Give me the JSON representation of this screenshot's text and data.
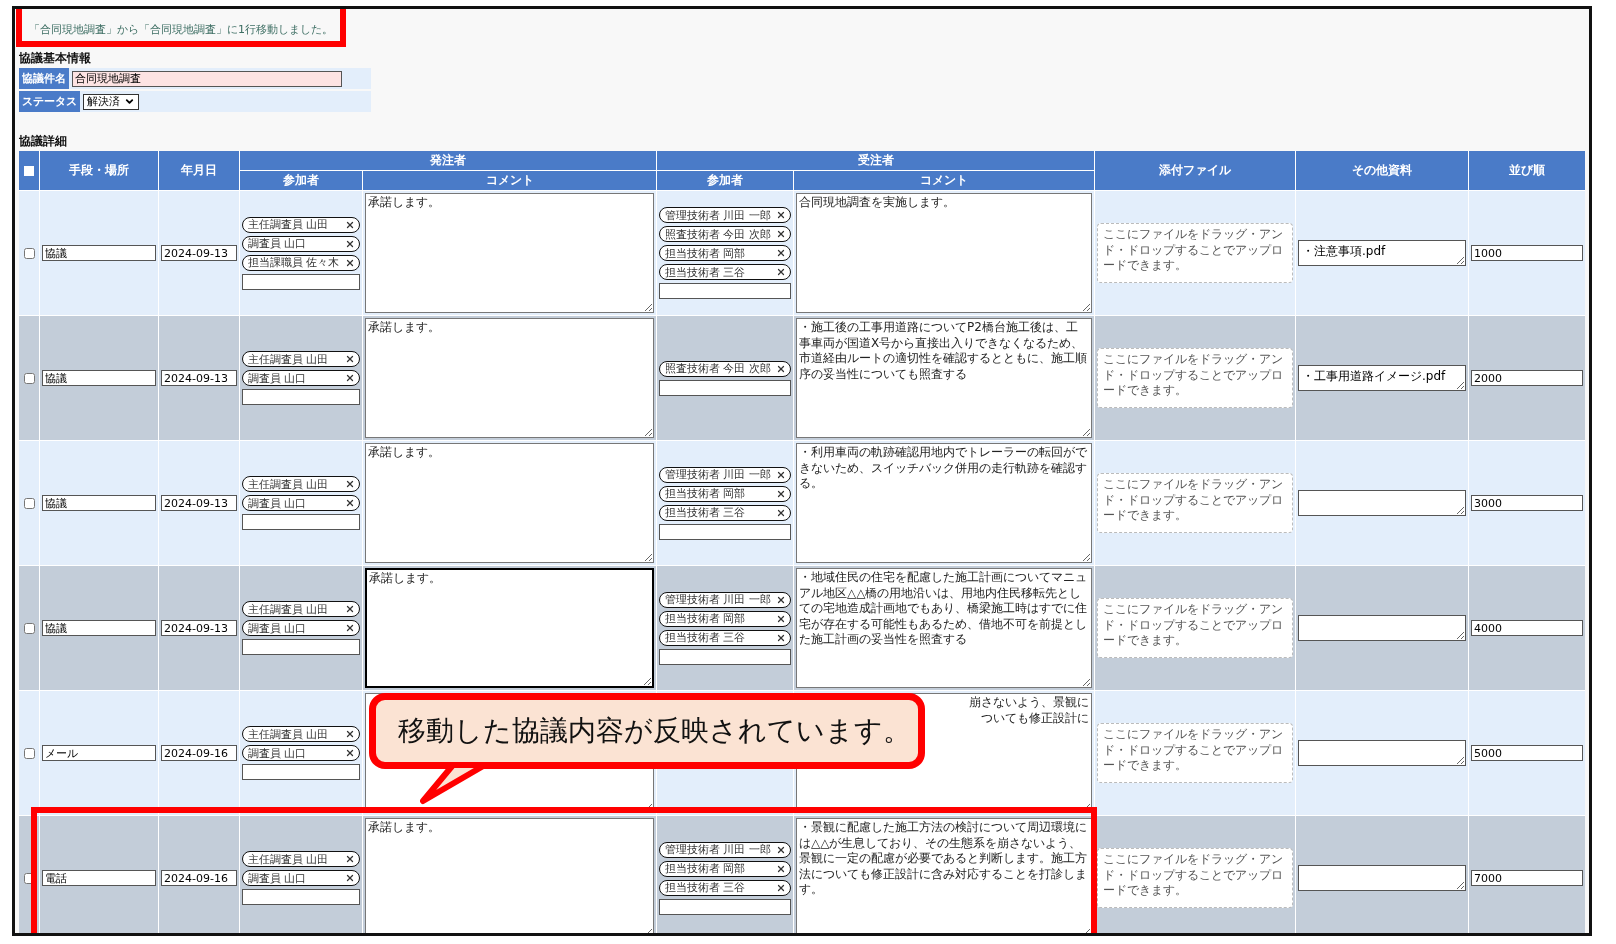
{
  "message": {
    "text": "「合同現地調査」から「合同現地調査」に1行移動しました。",
    "highlighted": true
  },
  "basic_info": {
    "heading": "協議基本情報",
    "fields": [
      {
        "kind": "text",
        "label": "協議件名",
        "value": "合同現地調査"
      },
      {
        "kind": "select",
        "label": "ステータス",
        "value": "解決済"
      }
    ]
  },
  "details": {
    "heading": "協議詳細",
    "select_all": {
      "checked": false
    },
    "columns": {
      "method": "手段・場所",
      "date": "年月日",
      "orderer": {
        "title": "発注者",
        "participants": "参加者",
        "comment": "コメント"
      },
      "receiver": {
        "title": "受注者",
        "participants": "参加者",
        "comment": "コメント"
      },
      "attachment": "添付ファイル",
      "other": "その他資料",
      "order": "並び順"
    },
    "rows": [
      {
        "checked": false,
        "highlighted": false,
        "covered_by_callout": false,
        "method": "協議",
        "date": "2024-09-13",
        "orderer_participants": [
          "主任調査員 山田",
          "調査員 山口",
          "担当課職員 佐々木"
        ],
        "orderer_comment": "承諾します。",
        "orderer_comment_focused": false,
        "receiver_participants": [
          "管理技術者 川田 一郎",
          "照査技術者 今田 次郎",
          "担当技術者 岡部",
          "担当技術者 三谷"
        ],
        "receiver_comment": "合同現地調査を実施します。",
        "upload_hint": "ここにファイルをドラッグ・アンド・ドロップすることでアップロードできます。",
        "other_files": "・注意事項.pdf",
        "sort_order": "1000"
      },
      {
        "checked": false,
        "highlighted": false,
        "covered_by_callout": false,
        "method": "協議",
        "date": "2024-09-13",
        "orderer_participants": [
          "主任調査員 山田",
          "調査員 山口"
        ],
        "orderer_comment": "承諾します。",
        "orderer_comment_focused": false,
        "receiver_participants": [
          "照査技術者 今田 次郎"
        ],
        "receiver_comment": "・施工後の工事用道路についてP2橋台施工後は、工事車両が国道X号から直接出入りできなくなるため、市道経由ルートの適切性を確認するとともに、施工順序の妥当性についても照査する",
        "upload_hint": "ここにファイルをドラッグ・アンド・ドロップすることでアップロードできます。",
        "other_files": "・工事用道路イメージ.pdf",
        "sort_order": "2000"
      },
      {
        "checked": false,
        "highlighted": false,
        "covered_by_callout": false,
        "method": "協議",
        "date": "2024-09-13",
        "orderer_participants": [
          "主任調査員 山田",
          "調査員 山口"
        ],
        "orderer_comment": "承諾します。",
        "orderer_comment_focused": false,
        "receiver_participants": [
          "管理技術者 川田 一郎",
          "担当技術者 岡部",
          "担当技術者 三谷"
        ],
        "receiver_comment": "・利用車両の軌跡確認用地内でトレーラーの転回ができないため、スイッチバック併用の走行軌跡を確認する。",
        "upload_hint": "ここにファイルをドラッグ・アンド・ドロップすることでアップロードできます。",
        "sort_order": "3000"
      },
      {
        "checked": false,
        "highlighted": false,
        "covered_by_callout": false,
        "method": "協議",
        "date": "2024-09-13",
        "orderer_participants": [
          "主任調査員 山田",
          "調査員 山口"
        ],
        "orderer_comment": "承諾します。",
        "orderer_comment_focused": true,
        "receiver_participants": [
          "管理技術者 川田 一郎",
          "担当技術者 岡部",
          "担当技術者 三谷"
        ],
        "receiver_comment": "・地域住民の住宅を配慮した施工計画についてマニュアル地区△△橋の用地沿いは、用地内住民移転先としての宅地造成計画地でもあり、橋梁施工時はすでに住宅が存在する可能性もあるため、借地不可を前提とした施工計画の妥当性を照査する",
        "upload_hint": "ここにファイルをドラッグ・アンド・ドロップすることでアップロードできます。",
        "sort_order": "4000"
      },
      {
        "checked": false,
        "highlighted": false,
        "covered_by_callout": true,
        "method": "メール",
        "date": "2024-09-16",
        "orderer_participants": [
          "主任調査員 山田",
          "調査員 山口"
        ],
        "orderer_comment_focused": false,
        "receiver_participants": [],
        "receiver_comment": [
          "崩さないよう、景観に",
          "ついても修正設計に"
        ],
        "upload_hint": "ここにファイルをドラッグ・アンド・ドロップすることでアップロードできます。",
        "sort_order": "5000"
      },
      {
        "checked": false,
        "highlighted": true,
        "covered_by_callout": false,
        "method": "電話",
        "date": "2024-09-16",
        "orderer_participants": [
          "主任調査員 山田",
          "調査員 山口"
        ],
        "orderer_comment": "承諾します。",
        "orderer_comment_focused": false,
        "receiver_participants": [
          "管理技術者 川田 一郎",
          "担当技術者 岡部",
          "担当技術者 三谷"
        ],
        "receiver_comment": "・景観に配慮した施工方法の検討について周辺環境には△△が生息しており、その生態系を崩さないよう、景観に一定の配慮が必要であると判断します。施工方法についても修正設計に含み対応することを打診します。",
        "upload_hint": "ここにファイルをドラッグ・アンド・ドロップすることでアップロードできます。",
        "sort_order": "7000"
      }
    ]
  },
  "callout": {
    "text": "移動した協議内容が反映されています。"
  }
}
